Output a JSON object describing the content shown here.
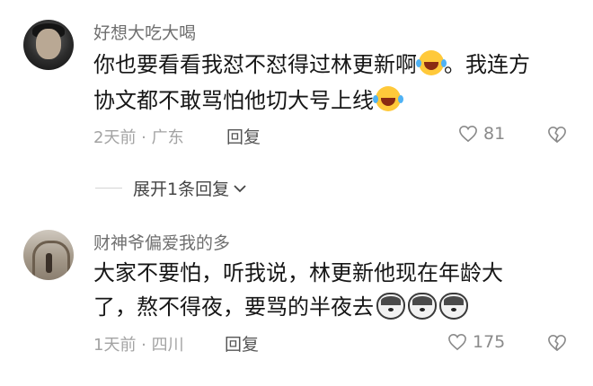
{
  "comments": [
    {
      "username": "好想大吃大喝",
      "line1": "你也要看看我怼不怼得过林更新啊",
      "line1_tail": "。我连方",
      "line2": "协文都不敢骂怕他切大号上线",
      "time": "2天前",
      "location": "广东",
      "reply": "回复",
      "likes": "81",
      "emoji": "laugh-cry-emoji"
    },
    {
      "username": "财神爷偏爱我的多",
      "line1": "大家不要怕，听我说，林更新他现在年龄大",
      "line2": "了，熬不得夜，要骂的半夜去",
      "time": "1天前",
      "location": "四川",
      "reply": "回复",
      "likes": "175",
      "emoji": "husky-dog-emoji"
    }
  ],
  "expand": {
    "label": "展开1条回复"
  },
  "colors": {
    "text": "#161616",
    "username": "#6f6f6f",
    "meta": "#a3a3a3"
  }
}
